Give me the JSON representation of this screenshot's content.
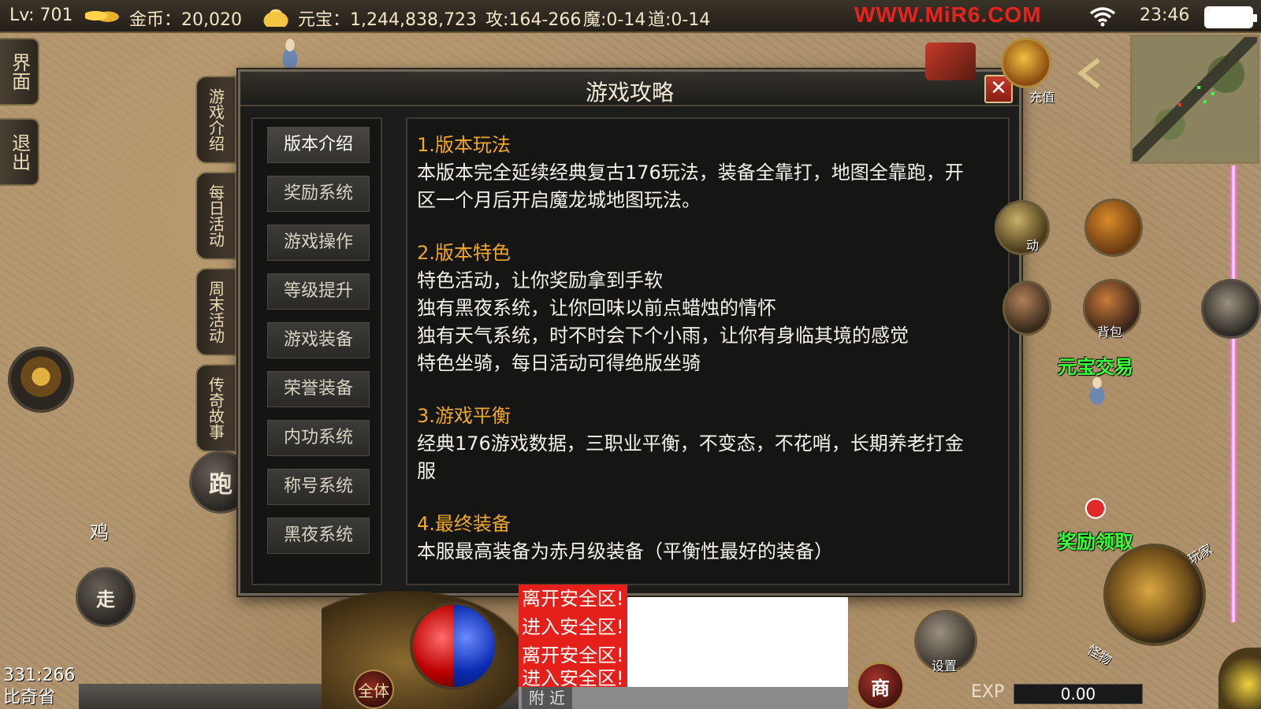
{
  "status_bar": {
    "level": "Lv: 701",
    "gold": "金币：20,020",
    "yuanbao": "元宝：1,244,838,723",
    "attack": "攻:164-266",
    "magic": "魔:0-14",
    "tao": "道:0-14",
    "site": "WWW.MiR6.COM",
    "time": "23:46"
  },
  "left_buttons": {
    "interface": "界面",
    "exit": "退出",
    "run": "跑",
    "walk": "走",
    "chicken_label": "鸡"
  },
  "side_tabs": [
    "游戏介绍",
    "每日活动",
    "周末活动",
    "传奇故事"
  ],
  "dialog": {
    "title": "游戏攻略",
    "close": "✕",
    "nav": [
      "版本介绍",
      "奖励系统",
      "游戏操作",
      "等级提升",
      "游戏装备",
      "荣誉装备",
      "内功系统",
      "称号系统",
      "黑夜系统"
    ],
    "active_nav": 0,
    "sections": [
      {
        "title": "1.版本玩法",
        "lines": [
          "本版本完全延续经典复古176玩法，装备全靠打，地图全靠跑，开",
          "区一个月后开启魔龙城地图玩法。"
        ]
      },
      {
        "title": "2.版本特色",
        "lines": [
          "特色活动，让你奖励拿到手软",
          "独有黑夜系统，让你回味以前点蜡烛的情怀",
          "独有天气系统，时不时会下个小雨，让你有身临其境的感觉",
          "特色坐骑，每日活动可得绝版坐骑"
        ]
      },
      {
        "title": "3.游戏平衡",
        "lines": [
          "经典176游戏数据，三职业平衡，不变态，不花哨，长期养老打金",
          "服"
        ]
      },
      {
        "title": "4.最终装备",
        "lines": [
          "本服最高装备为赤月级装备（平衡性最好的装备）"
        ]
      }
    ]
  },
  "right_panel": {
    "recharge": "充值",
    "bag": "背包",
    "activity": "动",
    "yuanbao_trade": "元宝交易",
    "reward_claim": "奖励领取",
    "player": "玩家",
    "monster": "怪物",
    "settings": "设置",
    "shop": "商"
  },
  "chat": {
    "lines": [
      "离开安全区!",
      "进入安全区!",
      "离开安全区!",
      "进入安全区!"
    ],
    "tab_nearby": "附 近"
  },
  "bottom": {
    "exp_label": "EXP",
    "exp_value": "0.00",
    "coords": "331:266",
    "map_name": "比奇省",
    "all_body": "全体"
  },
  "colors": {
    "section_title": "#f0a826",
    "site_red": "#e8231d",
    "green_label": "#3cff3c",
    "chat_red": "#e5201b"
  }
}
